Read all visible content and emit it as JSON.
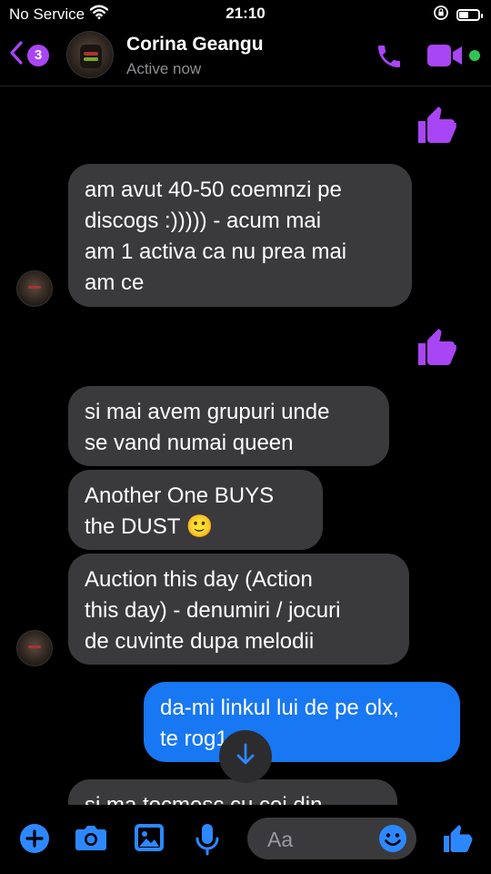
{
  "status": {
    "carrier": "No Service",
    "time": "21:10",
    "battery_level": 0.45
  },
  "header": {
    "badge_count": "3",
    "contact_name": "Corina Geangu",
    "contact_status": "Active now"
  },
  "messages": [
    {
      "text_lines": [
        "am avut 40-50 coemnzi pe",
        "discogs :))))) - acum mai",
        "am 1 activa ca nu prea mai",
        "am ce"
      ]
    },
    {
      "text_lines": [
        "si mai avem grupuri unde",
        "se vand numai queen"
      ]
    },
    {
      "text_lines": [
        "Another One BUYS",
        "the DUST 🙂"
      ]
    },
    {
      "text_lines": [
        "Auction this day (Action",
        "this day) - denumiri / jocuri",
        "de cuvinte dupa melodii"
      ]
    },
    {
      "text_lines": [
        "da-mi linkul lui de pe olx,",
        "te rog1"
      ]
    },
    {
      "text_lines": [
        "si ma tocmesc cu cei din"
      ]
    }
  ],
  "composer": {
    "placeholder": "Aa"
  },
  "colors": {
    "accent": "#a845f4",
    "bubble_incoming": "#3a3a3c",
    "bubble_outgoing": "#1877f2",
    "online": "#31c452",
    "composer_blue": "#2d88ff"
  }
}
